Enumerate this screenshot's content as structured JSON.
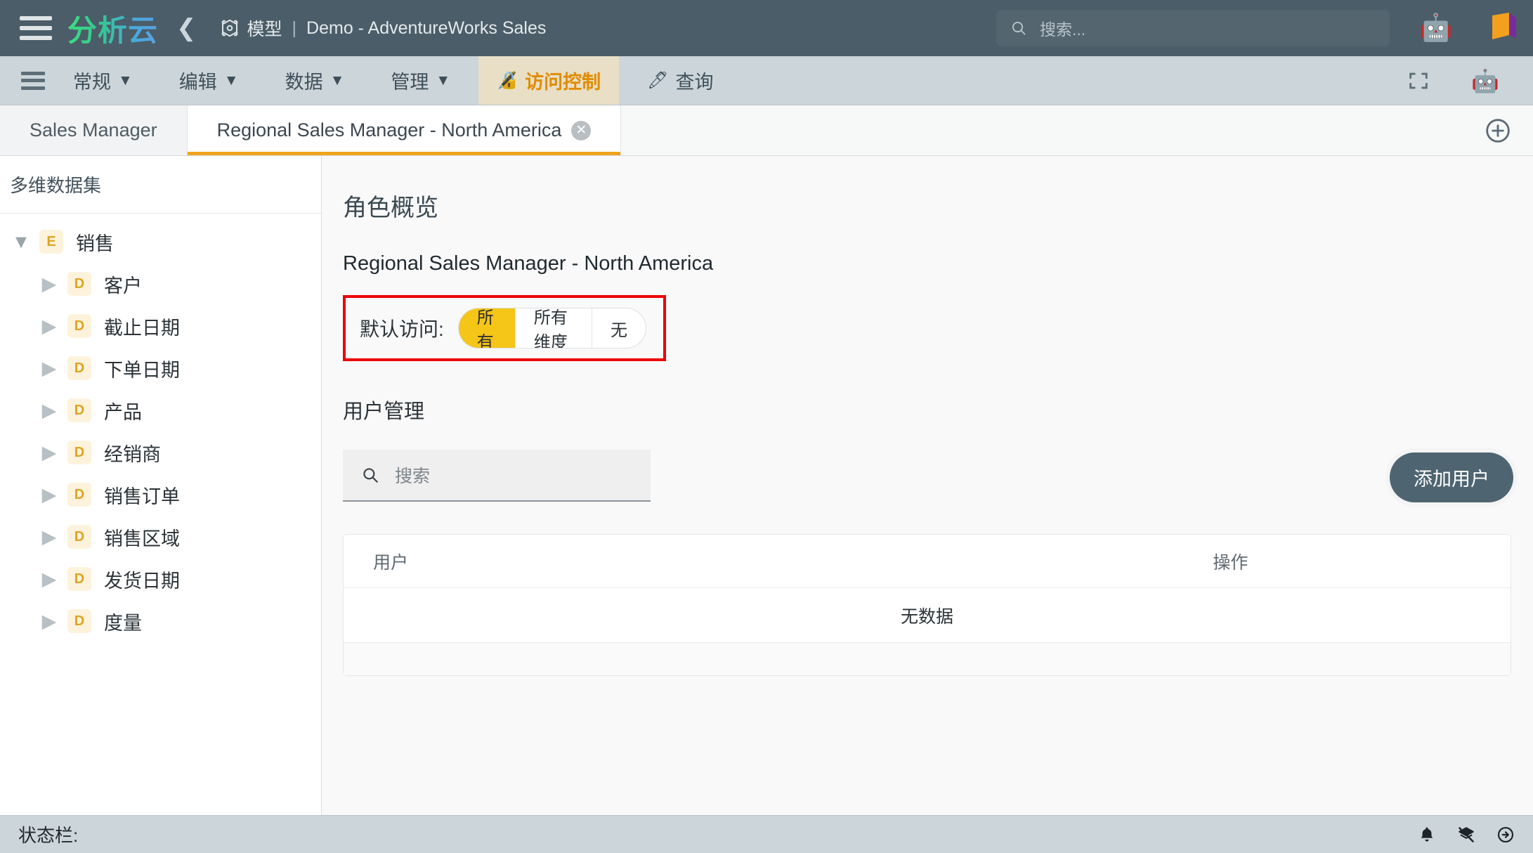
{
  "header": {
    "menu_icon": "hamburger-icon",
    "brand": "分析云",
    "back_icon": "chevron-left-icon",
    "model_icon": "cube-icon",
    "model_label": "模型",
    "separator": "|",
    "model_name": "Demo - AdventureWorks Sales",
    "search": {
      "icon": "search-icon",
      "placeholder": "搜索...",
      "value": ""
    },
    "robot_icon": "🤖",
    "app_logo_icon": "brand-flag-icon"
  },
  "menubar": {
    "grip_icon": "menu-grip-icon",
    "items": [
      {
        "label": "常规",
        "has_chevron": true,
        "active": false,
        "icon": ""
      },
      {
        "label": "编辑",
        "has_chevron": true,
        "active": false,
        "icon": ""
      },
      {
        "label": "数据",
        "has_chevron": true,
        "active": false,
        "icon": ""
      },
      {
        "label": "管理",
        "has_chevron": true,
        "active": false,
        "icon": ""
      },
      {
        "label": "访问控制",
        "has_chevron": false,
        "active": true,
        "icon": "🔏"
      },
      {
        "label": "查询",
        "has_chevron": false,
        "active": false,
        "icon": "🖊"
      }
    ],
    "expand_icon": "fullscreen-icon",
    "robot_icon": "🤖",
    "active_color": "#e08c00",
    "active_bg": "#e8dfc6"
  },
  "tabs": {
    "items": [
      {
        "label": "Sales Manager",
        "active": false,
        "closable": false
      },
      {
        "label": "Regional Sales Manager - North America",
        "active": true,
        "closable": true
      }
    ],
    "close_icon": "close-icon",
    "add_tab_icon": "plus-circle-icon",
    "active_underline_color": "#f0a41e"
  },
  "sidebar": {
    "title": "多维数据集",
    "tree": [
      {
        "label": "销售",
        "badge": "E",
        "level": 0,
        "expanded": true,
        "caret": "caret-down-icon"
      },
      {
        "label": "客户",
        "badge": "D",
        "level": 1,
        "expanded": false,
        "caret": "caret-right-icon"
      },
      {
        "label": "截止日期",
        "badge": "D",
        "level": 1,
        "expanded": false,
        "caret": "caret-right-icon"
      },
      {
        "label": "下单日期",
        "badge": "D",
        "level": 1,
        "expanded": false,
        "caret": "caret-right-icon"
      },
      {
        "label": "产品",
        "badge": "D",
        "level": 1,
        "expanded": false,
        "caret": "caret-right-icon"
      },
      {
        "label": "经销商",
        "badge": "D",
        "level": 1,
        "expanded": false,
        "caret": "caret-right-icon"
      },
      {
        "label": "销售订单",
        "badge": "D",
        "level": 1,
        "expanded": false,
        "caret": "caret-right-icon"
      },
      {
        "label": "销售区域",
        "badge": "D",
        "level": 1,
        "expanded": false,
        "caret": "caret-right-icon"
      },
      {
        "label": "发货日期",
        "badge": "D",
        "level": 1,
        "expanded": false,
        "caret": "caret-right-icon"
      },
      {
        "label": "度量",
        "badge": "D",
        "level": 1,
        "expanded": false,
        "caret": "caret-right-icon"
      }
    ]
  },
  "main": {
    "page_title": "角色概览",
    "role_name": "Regional Sales Manager - North America",
    "default_access": {
      "label": "默认访问:",
      "options": [
        "所有",
        "所有维度",
        "无"
      ],
      "selected": "所有",
      "selected_color": "#f5c518",
      "highlight_border_color": "#ee0000"
    },
    "user_management": {
      "title": "用户管理",
      "search": {
        "icon": "search-icon",
        "placeholder": "搜索",
        "value": ""
      },
      "add_user_label": "添加用户",
      "add_user_color": "#4e6471",
      "table": {
        "columns": [
          "用户",
          "操作"
        ],
        "rows": [],
        "empty_text": "无数据"
      }
    }
  },
  "statusbar": {
    "label": "状态栏:",
    "value": "",
    "icons": [
      "bell-icon",
      "layers-off-icon",
      "compass-arrow-icon"
    ]
  }
}
